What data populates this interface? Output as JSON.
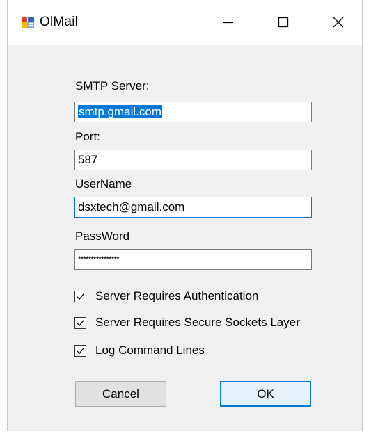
{
  "window": {
    "title": "OlMail",
    "controls": [
      "minimize-icon",
      "maximize-icon",
      "close-icon"
    ]
  },
  "form": {
    "smtp_label": "SMTP Server:",
    "smtp_value": "smtp.gmail.com",
    "port_label": "Port:",
    "port_value": "587",
    "username_label": "UserName",
    "username_value": "dsxtech@gmail.com",
    "password_label": "PassWord",
    "password_value": "****************"
  },
  "options": [
    {
      "label": "Server Requires Authentication",
      "checked": true
    },
    {
      "label": "Server Requires Secure Sockets Layer",
      "checked": true
    },
    {
      "label": "Log Command Lines",
      "checked": true
    }
  ],
  "buttons": {
    "cancel_label": "Cancel",
    "ok_label": "OK"
  },
  "colors": {
    "accent": "#0078d7",
    "dialog_background": "#f0f0f0",
    "titlebar_background": "#ffffff"
  }
}
